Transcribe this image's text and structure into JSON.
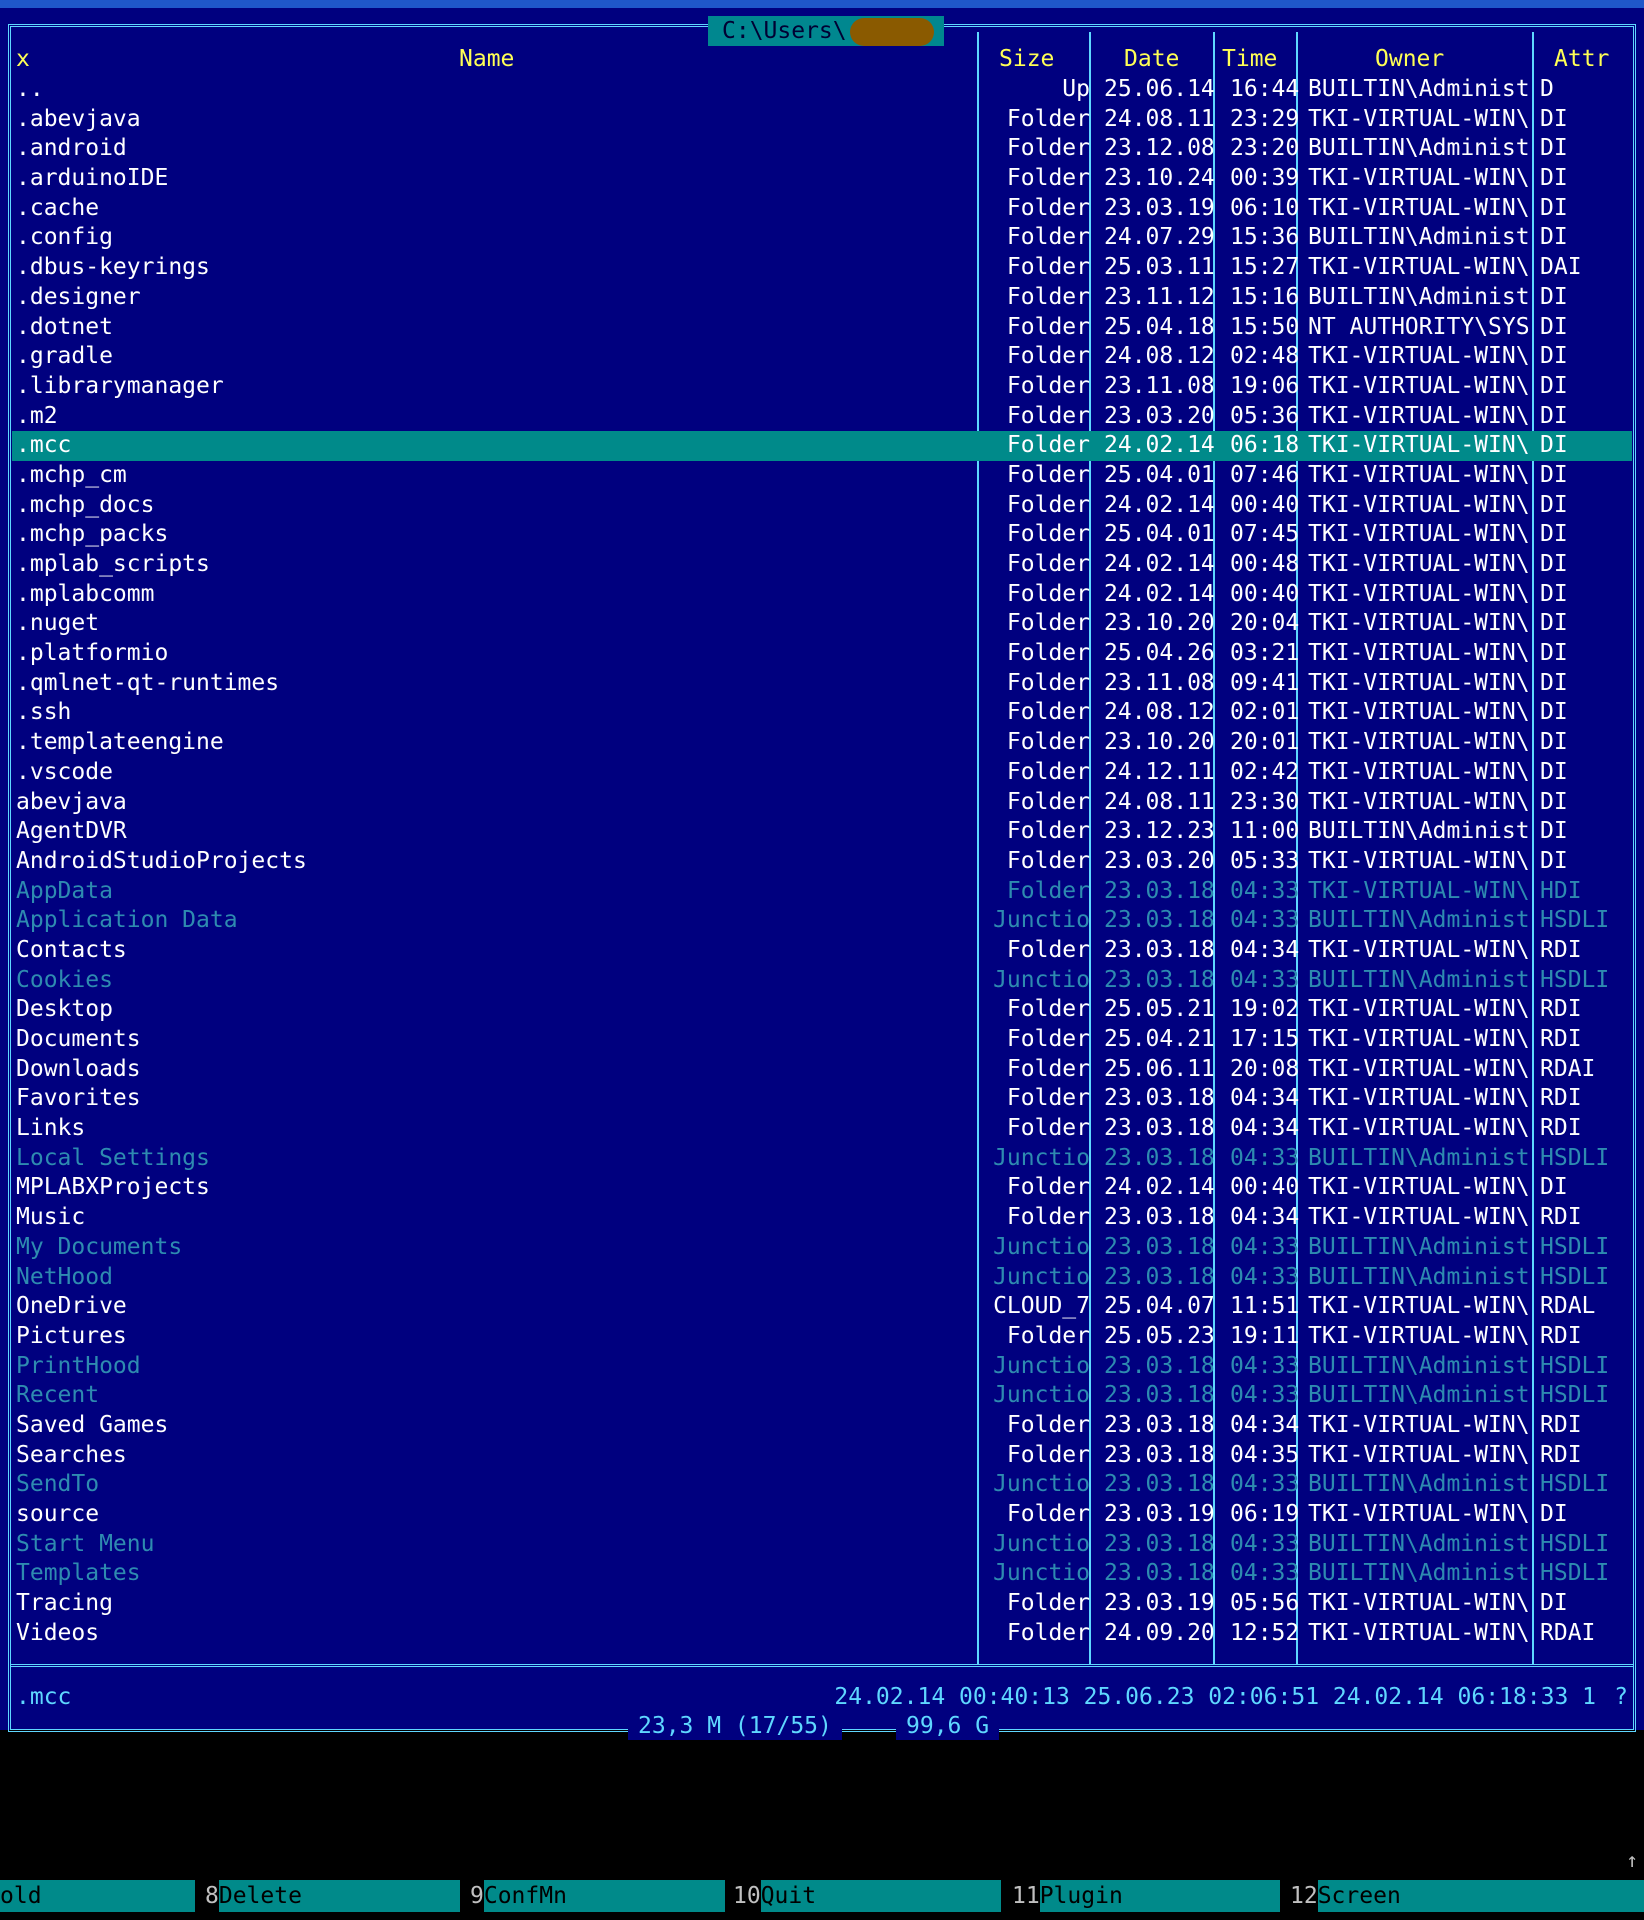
{
  "window": {
    "path": "C:\\Users\\"
  },
  "columns": {
    "mark": "x",
    "name": "Name",
    "size": "Size",
    "date": "Date",
    "time": "Time",
    "owner": "Owner",
    "attr": "Attr"
  },
  "files": [
    {
      "name": "..",
      "size": "Up",
      "date": "25.06.14",
      "time": "16:44",
      "owner": "BUILTIN\\Administ",
      "attr": "D",
      "style": "dotdot"
    },
    {
      "name": ".abevjava",
      "size": "Folder",
      "date": "24.08.11",
      "time": "23:29",
      "owner": "TKI-VIRTUAL-WIN\\",
      "attr": "DI",
      "style": "normal"
    },
    {
      "name": ".android",
      "size": "Folder",
      "date": "23.12.08",
      "time": "23:20",
      "owner": "BUILTIN\\Administ",
      "attr": "DI",
      "style": "normal"
    },
    {
      "name": ".arduinoIDE",
      "size": "Folder",
      "date": "23.10.24",
      "time": "00:39",
      "owner": "TKI-VIRTUAL-WIN\\",
      "attr": "DI",
      "style": "normal"
    },
    {
      "name": ".cache",
      "size": "Folder",
      "date": "23.03.19",
      "time": "06:10",
      "owner": "TKI-VIRTUAL-WIN\\",
      "attr": "DI",
      "style": "normal"
    },
    {
      "name": ".config",
      "size": "Folder",
      "date": "24.07.29",
      "time": "15:36",
      "owner": "BUILTIN\\Administ",
      "attr": "DI",
      "style": "normal"
    },
    {
      "name": ".dbus-keyrings",
      "size": "Folder",
      "date": "25.03.11",
      "time": "15:27",
      "owner": "TKI-VIRTUAL-WIN\\",
      "attr": "DAI",
      "style": "normal"
    },
    {
      "name": ".designer",
      "size": "Folder",
      "date": "23.11.12",
      "time": "15:16",
      "owner": "BUILTIN\\Administ",
      "attr": "DI",
      "style": "normal"
    },
    {
      "name": ".dotnet",
      "size": "Folder",
      "date": "25.04.18",
      "time": "15:50",
      "owner": "NT AUTHORITY\\SYS",
      "attr": "DI",
      "style": "normal"
    },
    {
      "name": ".gradle",
      "size": "Folder",
      "date": "24.08.12",
      "time": "02:48",
      "owner": "TKI-VIRTUAL-WIN\\",
      "attr": "DI",
      "style": "normal"
    },
    {
      "name": ".librarymanager",
      "size": "Folder",
      "date": "23.11.08",
      "time": "19:06",
      "owner": "TKI-VIRTUAL-WIN\\",
      "attr": "DI",
      "style": "normal"
    },
    {
      "name": ".m2",
      "size": "Folder",
      "date": "23.03.20",
      "time": "05:36",
      "owner": "TKI-VIRTUAL-WIN\\",
      "attr": "DI",
      "style": "normal"
    },
    {
      "name": ".mcc",
      "size": "Folder",
      "date": "24.02.14",
      "time": "06:18",
      "owner": "TKI-VIRTUAL-WIN\\",
      "attr": "DI",
      "style": "selected"
    },
    {
      "name": ".mchp_cm",
      "size": "Folder",
      "date": "25.04.01",
      "time": "07:46",
      "owner": "TKI-VIRTUAL-WIN\\",
      "attr": "DI",
      "style": "normal"
    },
    {
      "name": ".mchp_docs",
      "size": "Folder",
      "date": "24.02.14",
      "time": "00:40",
      "owner": "TKI-VIRTUAL-WIN\\",
      "attr": "DI",
      "style": "normal"
    },
    {
      "name": ".mchp_packs",
      "size": "Folder",
      "date": "25.04.01",
      "time": "07:45",
      "owner": "TKI-VIRTUAL-WIN\\",
      "attr": "DI",
      "style": "normal"
    },
    {
      "name": ".mplab_scripts",
      "size": "Folder",
      "date": "24.02.14",
      "time": "00:48",
      "owner": "TKI-VIRTUAL-WIN\\",
      "attr": "DI",
      "style": "normal"
    },
    {
      "name": ".mplabcomm",
      "size": "Folder",
      "date": "24.02.14",
      "time": "00:40",
      "owner": "TKI-VIRTUAL-WIN\\",
      "attr": "DI",
      "style": "normal"
    },
    {
      "name": ".nuget",
      "size": "Folder",
      "date": "23.10.20",
      "time": "20:04",
      "owner": "TKI-VIRTUAL-WIN\\",
      "attr": "DI",
      "style": "normal"
    },
    {
      "name": ".platformio",
      "size": "Folder",
      "date": "25.04.26",
      "time": "03:21",
      "owner": "TKI-VIRTUAL-WIN\\",
      "attr": "DI",
      "style": "normal"
    },
    {
      "name": ".qmlnet-qt-runtimes",
      "size": "Folder",
      "date": "23.11.08",
      "time": "09:41",
      "owner": "TKI-VIRTUAL-WIN\\",
      "attr": "DI",
      "style": "normal"
    },
    {
      "name": ".ssh",
      "size": "Folder",
      "date": "24.08.12",
      "time": "02:01",
      "owner": "TKI-VIRTUAL-WIN\\",
      "attr": "DI",
      "style": "normal"
    },
    {
      "name": ".templateengine",
      "size": "Folder",
      "date": "23.10.20",
      "time": "20:01",
      "owner": "TKI-VIRTUAL-WIN\\",
      "attr": "DI",
      "style": "normal"
    },
    {
      "name": ".vscode",
      "size": "Folder",
      "date": "24.12.11",
      "time": "02:42",
      "owner": "TKI-VIRTUAL-WIN\\",
      "attr": "DI",
      "style": "normal"
    },
    {
      "name": "abevjava",
      "size": "Folder",
      "date": "24.08.11",
      "time": "23:30",
      "owner": "TKI-VIRTUAL-WIN\\",
      "attr": "DI",
      "style": "normal"
    },
    {
      "name": "AgentDVR",
      "size": "Folder",
      "date": "23.12.23",
      "time": "11:00",
      "owner": "BUILTIN\\Administ",
      "attr": "DI",
      "style": "normal"
    },
    {
      "name": "AndroidStudioProjects",
      "size": "Folder",
      "date": "23.03.20",
      "time": "05:33",
      "owner": "TKI-VIRTUAL-WIN\\",
      "attr": "DI",
      "style": "normal"
    },
    {
      "name": "AppData",
      "size": "Folder",
      "date": "23.03.18",
      "time": "04:33",
      "owner": "TKI-VIRTUAL-WIN\\",
      "attr": "HDI",
      "style": "hidden"
    },
    {
      "name": "Application Data",
      "size": "Junctio",
      "date": "23.03.18",
      "time": "04:33",
      "owner": "BUILTIN\\Administ",
      "attr": "HSDLI",
      "style": "hidden"
    },
    {
      "name": "Contacts",
      "size": "Folder",
      "date": "23.03.18",
      "time": "04:34",
      "owner": "TKI-VIRTUAL-WIN\\",
      "attr": "RDI",
      "style": "normal"
    },
    {
      "name": "Cookies",
      "size": "Junctio",
      "date": "23.03.18",
      "time": "04:33",
      "owner": "BUILTIN\\Administ",
      "attr": "HSDLI",
      "style": "hidden"
    },
    {
      "name": "Desktop",
      "size": "Folder",
      "date": "25.05.21",
      "time": "19:02",
      "owner": "TKI-VIRTUAL-WIN\\",
      "attr": "RDI",
      "style": "normal"
    },
    {
      "name": "Documents",
      "size": "Folder",
      "date": "25.04.21",
      "time": "17:15",
      "owner": "TKI-VIRTUAL-WIN\\",
      "attr": "RDI",
      "style": "normal"
    },
    {
      "name": "Downloads",
      "size": "Folder",
      "date": "25.06.11",
      "time": "20:08",
      "owner": "TKI-VIRTUAL-WIN\\",
      "attr": "RDAI",
      "style": "normal"
    },
    {
      "name": "Favorites",
      "size": "Folder",
      "date": "23.03.18",
      "time": "04:34",
      "owner": "TKI-VIRTUAL-WIN\\",
      "attr": "RDI",
      "style": "normal"
    },
    {
      "name": "Links",
      "size": "Folder",
      "date": "23.03.18",
      "time": "04:34",
      "owner": "TKI-VIRTUAL-WIN\\",
      "attr": "RDI",
      "style": "normal"
    },
    {
      "name": "Local Settings",
      "size": "Junctio",
      "date": "23.03.18",
      "time": "04:33",
      "owner": "BUILTIN\\Administ",
      "attr": "HSDLI",
      "style": "hidden"
    },
    {
      "name": "MPLABXProjects",
      "size": "Folder",
      "date": "24.02.14",
      "time": "00:40",
      "owner": "TKI-VIRTUAL-WIN\\",
      "attr": "DI",
      "style": "normal"
    },
    {
      "name": "Music",
      "size": "Folder",
      "date": "23.03.18",
      "time": "04:34",
      "owner": "TKI-VIRTUAL-WIN\\",
      "attr": "RDI",
      "style": "normal"
    },
    {
      "name": "My Documents",
      "size": "Junctio",
      "date": "23.03.18",
      "time": "04:33",
      "owner": "BUILTIN\\Administ",
      "attr": "HSDLI",
      "style": "hidden"
    },
    {
      "name": "NetHood",
      "size": "Junctio",
      "date": "23.03.18",
      "time": "04:33",
      "owner": "BUILTIN\\Administ",
      "attr": "HSDLI",
      "style": "hidden"
    },
    {
      "name": "OneDrive",
      "size": "CLOUD_7",
      "date": "25.04.07",
      "time": "11:51",
      "owner": "TKI-VIRTUAL-WIN\\",
      "attr": "RDAL",
      "style": "normal"
    },
    {
      "name": "Pictures",
      "size": "Folder",
      "date": "25.05.23",
      "time": "19:11",
      "owner": "TKI-VIRTUAL-WIN\\",
      "attr": "RDI",
      "style": "normal"
    },
    {
      "name": "PrintHood",
      "size": "Junctio",
      "date": "23.03.18",
      "time": "04:33",
      "owner": "BUILTIN\\Administ",
      "attr": "HSDLI",
      "style": "hidden"
    },
    {
      "name": "Recent",
      "size": "Junctio",
      "date": "23.03.18",
      "time": "04:33",
      "owner": "BUILTIN\\Administ",
      "attr": "HSDLI",
      "style": "hidden"
    },
    {
      "name": "Saved Games",
      "size": "Folder",
      "date": "23.03.18",
      "time": "04:34",
      "owner": "TKI-VIRTUAL-WIN\\",
      "attr": "RDI",
      "style": "normal"
    },
    {
      "name": "Searches",
      "size": "Folder",
      "date": "23.03.18",
      "time": "04:35",
      "owner": "TKI-VIRTUAL-WIN\\",
      "attr": "RDI",
      "style": "normal"
    },
    {
      "name": "SendTo",
      "size": "Junctio",
      "date": "23.03.18",
      "time": "04:33",
      "owner": "BUILTIN\\Administ",
      "attr": "HSDLI",
      "style": "hidden"
    },
    {
      "name": "source",
      "size": "Folder",
      "date": "23.03.19",
      "time": "06:19",
      "owner": "TKI-VIRTUAL-WIN\\",
      "attr": "DI",
      "style": "normal"
    },
    {
      "name": "Start Menu",
      "size": "Junctio",
      "date": "23.03.18",
      "time": "04:33",
      "owner": "BUILTIN\\Administ",
      "attr": "HSDLI",
      "style": "hidden"
    },
    {
      "name": "Templates",
      "size": "Junctio",
      "date": "23.03.18",
      "time": "04:33",
      "owner": "BUILTIN\\Administ",
      "attr": "HSDLI",
      "style": "hidden"
    },
    {
      "name": "Tracing",
      "size": "Folder",
      "date": "23.03.19",
      "time": "05:56",
      "owner": "TKI-VIRTUAL-WIN\\",
      "attr": "DI",
      "style": "normal"
    },
    {
      "name": "Videos",
      "size": "Folder",
      "date": "24.09.20",
      "time": "12:52",
      "owner": "TKI-VIRTUAL-WIN\\",
      "attr": "RDAI",
      "style": "normal"
    }
  ],
  "status": {
    "selected_name": ".mcc",
    "times": "24.02.14 00:40:13 25.06.23 02:06:51 24.02.14 06:18:33  1",
    "help": "?"
  },
  "summary": {
    "size_info": "23,3 M (17/55)",
    "free_space": "99,6 G"
  },
  "fkeys": [
    {
      "num": "",
      "label": "old"
    },
    {
      "num": "8",
      "label": "Delete"
    },
    {
      "num": "9",
      "label": "ConfMn"
    },
    {
      "num": "10",
      "label": "Quit"
    },
    {
      "num": "11",
      "label": "Plugin"
    },
    {
      "num": "12",
      "label": "Screen"
    }
  ],
  "scroll_indicator": "↑",
  "colors": {
    "panel_bg": "#00007f",
    "frame": "#5fd7ff",
    "header_text": "#ffff55",
    "selected_bg": "#008a8a",
    "hidden_text": "#2e8bb0",
    "fkey_bg": "#008a8a"
  }
}
